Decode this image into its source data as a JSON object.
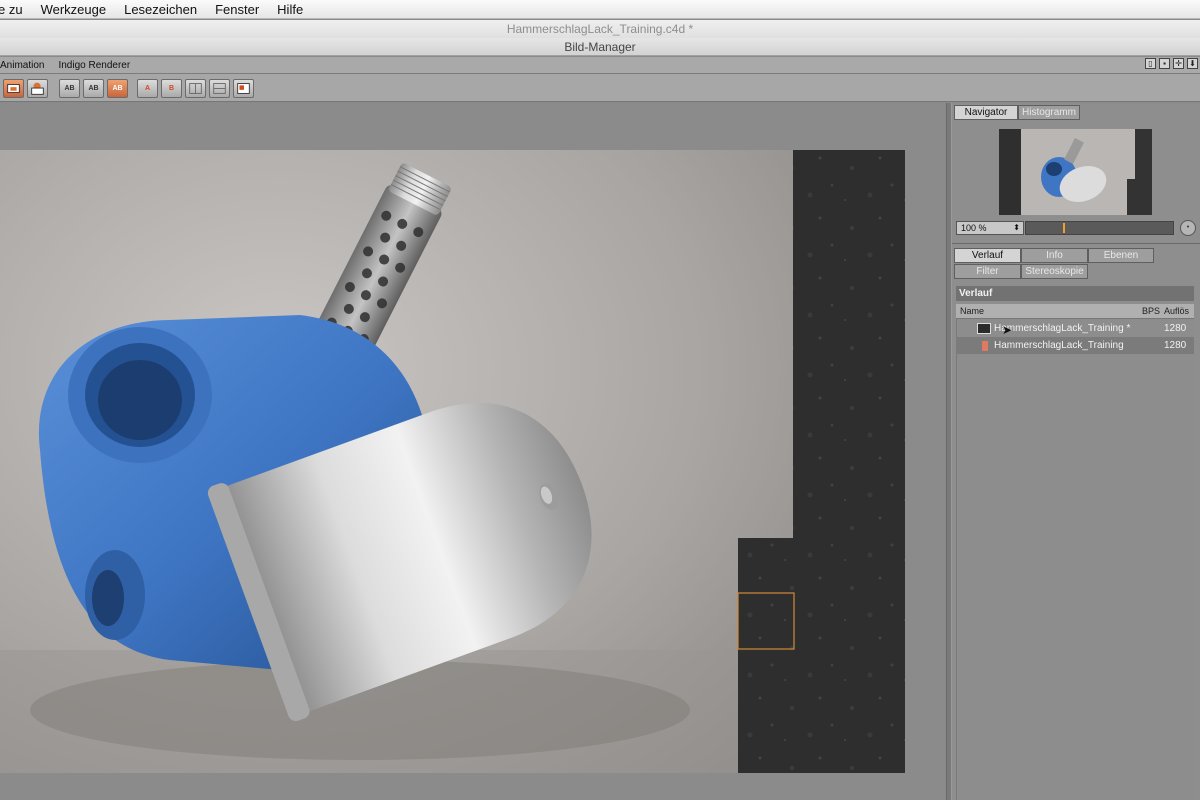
{
  "menubar": {
    "items": [
      "e zu",
      "Werkzeuge",
      "Lesezeichen",
      "Fenster",
      "Hilfe"
    ]
  },
  "windows": {
    "document_title": "HammerschlagLack_Training.c4d *",
    "manager_title": "Bild-Manager"
  },
  "app_menu": {
    "items": [
      "Animation",
      "Indigo Renderer"
    ]
  },
  "toolbar": {
    "buttons": [
      {
        "icon": "render-view-icon",
        "label": ""
      },
      {
        "icon": "render-picture-icon",
        "label": ""
      },
      {
        "icon": "ab-compare-icon",
        "label": "AB"
      },
      {
        "icon": "ab-swap-icon",
        "label": "AB"
      },
      {
        "icon": "ab-orange-icon",
        "label": "AB"
      },
      {
        "icon": "set-a-icon",
        "label": "A"
      },
      {
        "icon": "set-b-icon",
        "label": "B"
      },
      {
        "icon": "split-vertical-icon",
        "label": ""
      },
      {
        "icon": "split-horizontal-icon",
        "label": ""
      },
      {
        "icon": "image-info-icon",
        "label": ""
      }
    ]
  },
  "navigator": {
    "tabs": [
      "Navigator",
      "Histogramm"
    ],
    "active_tab": "Navigator",
    "zoom_value": "100 %"
  },
  "history_tabs": {
    "row1": [
      "Verlauf",
      "Info",
      "Ebenen"
    ],
    "row2": [
      "Filter",
      "Stereoskopie"
    ],
    "active_tab": "Verlauf"
  },
  "history_panel": {
    "section_title": "Verlauf",
    "columns": [
      "Name",
      "BPS",
      "Auflös"
    ],
    "rows": [
      {
        "name": "HammerschlagLack_Training *",
        "resolution": "1280"
      },
      {
        "name": "HammerschlagLack_Training",
        "resolution": "1280"
      }
    ]
  },
  "colors": {
    "accent_orange": "#f0a030",
    "tab_active": "#d4d4d4",
    "panel_bg": "#8e8e8e",
    "object_blue": "#3f76c4"
  }
}
